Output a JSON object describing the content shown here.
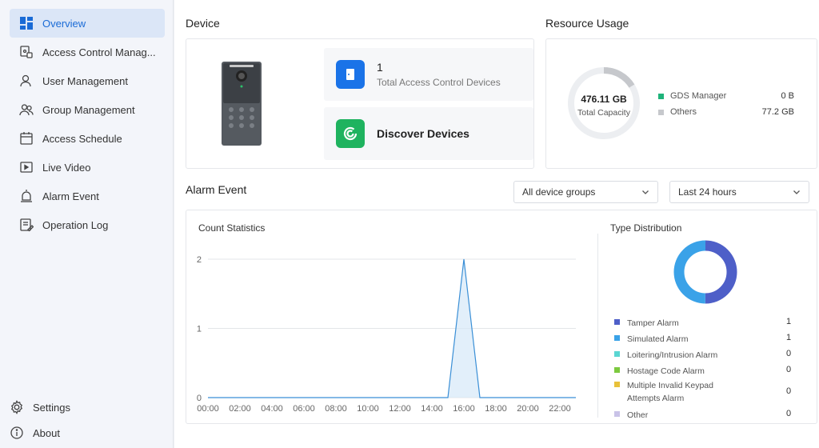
{
  "sidebar": {
    "items": [
      {
        "label": "Overview",
        "icon": "dashboard-icon",
        "active": true
      },
      {
        "label": "Access Control Manag...",
        "icon": "access-control-icon"
      },
      {
        "label": "User Management",
        "icon": "user-icon"
      },
      {
        "label": "Group Management",
        "icon": "group-icon"
      },
      {
        "label": "Access Schedule",
        "icon": "calendar-icon"
      },
      {
        "label": "Live Video",
        "icon": "video-icon"
      },
      {
        "label": "Alarm Event",
        "icon": "alarm-icon"
      },
      {
        "label": "Operation Log",
        "icon": "log-icon"
      }
    ],
    "settings_label": "Settings",
    "about_label": "About"
  },
  "device": {
    "title": "Device",
    "total_count": "1",
    "total_label": "Total Access Control Devices",
    "discover_label": "Discover Devices"
  },
  "resource": {
    "title": "Resource Usage",
    "capacity_value": "476.11 GB",
    "capacity_label": "Total Capacity",
    "legend": [
      {
        "label": "GDS Manager",
        "value": "0 B",
        "color": "#1fb37a"
      },
      {
        "label": "Others",
        "value": "77.2 GB",
        "color": "#c6c8cc"
      }
    ]
  },
  "alarm": {
    "title": "Alarm Event",
    "group_filter": "All device groups",
    "time_filter": "Last 24 hours",
    "count_title": "Count Statistics",
    "type_title": "Type Distribution",
    "types": [
      {
        "label": "Tamper Alarm",
        "value": "1",
        "color": "#4e5fc8"
      },
      {
        "label": "Simulated Alarm",
        "value": "1",
        "color": "#3aa2e8"
      },
      {
        "label": "Loitering/Intrusion Alarm",
        "value": "0",
        "color": "#5ad6d2"
      },
      {
        "label": "Hostage Code Alarm",
        "value": "0",
        "color": "#7cc93f"
      },
      {
        "label": "Multiple Invalid Keypad Attempts Alarm",
        "value": "0",
        "color": "#e8c13a"
      },
      {
        "label": "Other",
        "value": "0",
        "color": "#c9c3e8"
      }
    ]
  },
  "chart_data": {
    "type": "area",
    "title": "Count Statistics",
    "x": [
      "00:00",
      "01:00",
      "02:00",
      "03:00",
      "04:00",
      "05:00",
      "06:00",
      "07:00",
      "08:00",
      "09:00",
      "10:00",
      "11:00",
      "12:00",
      "13:00",
      "14:00",
      "15:00",
      "16:00",
      "17:00",
      "18:00",
      "19:00",
      "20:00",
      "21:00",
      "22:00",
      "23:00"
    ],
    "x_ticks": [
      "00:00",
      "02:00",
      "04:00",
      "06:00",
      "08:00",
      "10:00",
      "12:00",
      "14:00",
      "16:00",
      "18:00",
      "20:00",
      "22:00"
    ],
    "y_ticks": [
      "0",
      "1",
      "2"
    ],
    "values": [
      0,
      0,
      0,
      0,
      0,
      0,
      0,
      0,
      0,
      0,
      0,
      0,
      0,
      0,
      0,
      0,
      2,
      0,
      0,
      0,
      0,
      0,
      0,
      0
    ],
    "ylim": [
      0,
      2
    ],
    "color": "#3a8fd6",
    "grid": true
  }
}
